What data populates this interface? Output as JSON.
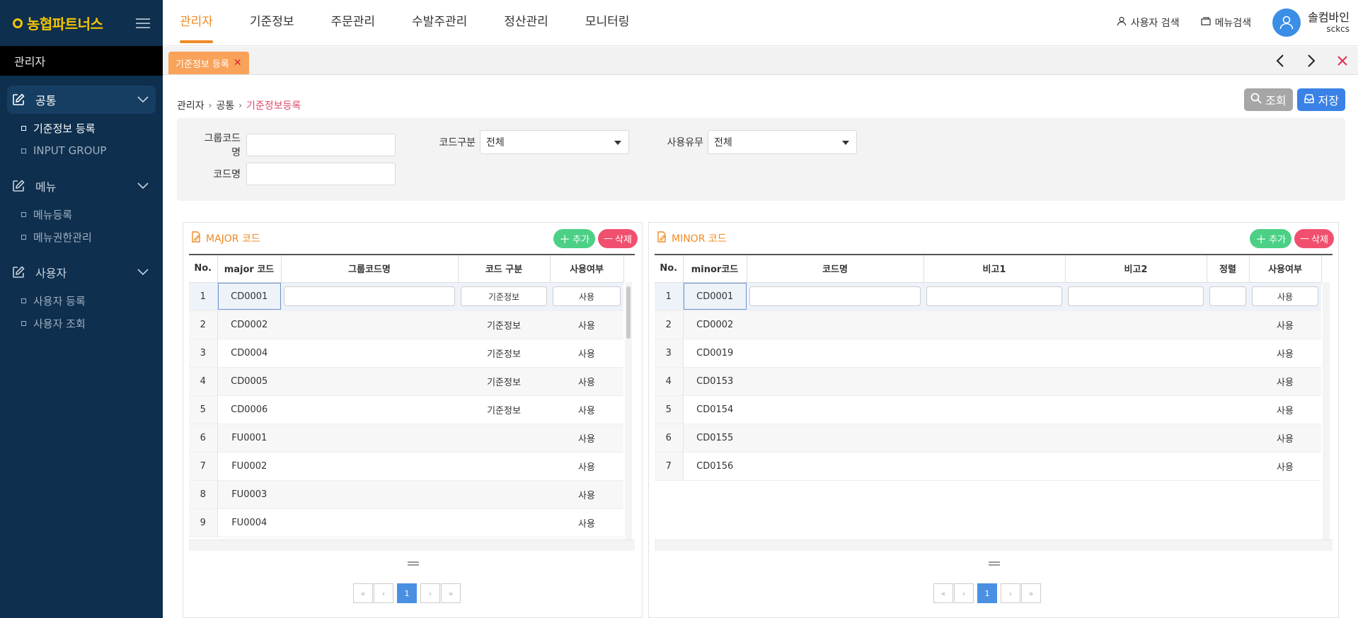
{
  "logo": {
    "text": "농협파트너스"
  },
  "sidebar": {
    "title": "관리자",
    "groups": [
      {
        "label": "공통",
        "items": [
          {
            "label": "기준정보 등록"
          },
          {
            "label": "INPUT GROUP"
          }
        ]
      },
      {
        "label": "메뉴",
        "items": [
          {
            "label": "메뉴등록"
          },
          {
            "label": "메뉴권한관리"
          }
        ]
      },
      {
        "label": "사용자",
        "items": [
          {
            "label": "사용자 등록"
          },
          {
            "label": "사용자 조회"
          }
        ]
      }
    ]
  },
  "topnav": {
    "menu": [
      "관리자",
      "기준정보",
      "주문관리",
      "수발주관리",
      "정산관리",
      "모니터링"
    ],
    "user_search": "사용자 검색",
    "menu_search": "메뉴검색",
    "user_name": "솔컴바인",
    "user_id": "sckcs"
  },
  "tabbar": {
    "tab_label": "기준정보 등록"
  },
  "breadcrumb": [
    "관리자",
    "공통",
    "기준정보등록"
  ],
  "actions": {
    "search": "조회",
    "save": "저장"
  },
  "filter": {
    "group_code_label": "그룹코드명",
    "code_type_label": "코드구분",
    "code_type_value": "전체",
    "use_label": "사용유무",
    "use_value": "전체",
    "code_name_label": "코드명"
  },
  "major": {
    "title": "MAJOR 코드",
    "add": "추가",
    "delete": "삭제",
    "headers": [
      "No.",
      "major 코드",
      "그룹코드명",
      "코드 구분",
      "사용여부"
    ],
    "rows": [
      {
        "no": "1",
        "code": "CD0001",
        "type": "기준정보",
        "use": "사용"
      },
      {
        "no": "2",
        "code": "CD0002",
        "type": "기준정보",
        "use": "사용"
      },
      {
        "no": "3",
        "code": "CD0004",
        "type": "기준정보",
        "use": "사용"
      },
      {
        "no": "4",
        "code": "CD0005",
        "type": "기준정보",
        "use": "사용"
      },
      {
        "no": "5",
        "code": "CD0006",
        "type": "기준정보",
        "use": "사용"
      },
      {
        "no": "6",
        "code": "FU0001",
        "type": "",
        "use": "사용"
      },
      {
        "no": "7",
        "code": "FU0002",
        "type": "",
        "use": "사용"
      },
      {
        "no": "8",
        "code": "FU0003",
        "type": "",
        "use": "사용"
      },
      {
        "no": "9",
        "code": "FU0004",
        "type": "",
        "use": "사용"
      }
    ],
    "page": "1"
  },
  "minor": {
    "title": "MINOR 코드",
    "add": "추가",
    "delete": "삭제",
    "headers": [
      "No.",
      "minor코드",
      "코드명",
      "비고1",
      "비고2",
      "정렬",
      "사용여부"
    ],
    "rows": [
      {
        "no": "1",
        "code": "CD0001",
        "use": "사용"
      },
      {
        "no": "2",
        "code": "CD0002",
        "use": "사용"
      },
      {
        "no": "3",
        "code": "CD0019",
        "use": "사용"
      },
      {
        "no": "4",
        "code": "CD0153",
        "use": "사용"
      },
      {
        "no": "5",
        "code": "CD0154",
        "use": "사용"
      },
      {
        "no": "6",
        "code": "CD0155",
        "use": "사용"
      },
      {
        "no": "7",
        "code": "CD0156",
        "use": "사용"
      }
    ],
    "page": "1"
  },
  "pager": {
    "first": "«",
    "prev": "‹",
    "next": "›",
    "last": "»"
  },
  "colors": {
    "accent": "#f08a24",
    "sidebar": "#0e2f4d",
    "primary": "#3a82e6",
    "add": "#4bd086",
    "delete": "#f0506e"
  }
}
